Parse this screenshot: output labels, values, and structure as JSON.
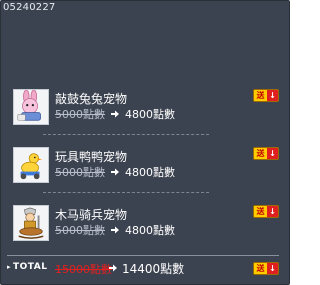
{
  "panel": {
    "id_text": "05240227"
  },
  "items": [
    {
      "name": "敲鼓兔兔宠物",
      "old_price": "5000點數",
      "new_price": "4800點數",
      "thumb_icon": "pink-rabbit-drummer-pet-icon"
    },
    {
      "name": "玩具鸭鸭宠物",
      "old_price": "5000點數",
      "new_price": "4800點數",
      "thumb_icon": "toy-duck-pet-icon"
    },
    {
      "name": "木马骑兵宠物",
      "old_price": "5000點數",
      "new_price": "4800點數",
      "thumb_icon": "rocking-horse-knight-pet-icon"
    }
  ],
  "gift_button": {
    "left_glyph": "送",
    "right_glyph": "↓"
  },
  "total": {
    "label": "TOTAL",
    "old_price": "15000點數",
    "new_price": "14400點數"
  },
  "colors": {
    "panel_bg": "#3c4350",
    "old_price_total": "#e4201f",
    "gift_yellow": "#ffcc00",
    "gift_red": "#e01f1f"
  }
}
